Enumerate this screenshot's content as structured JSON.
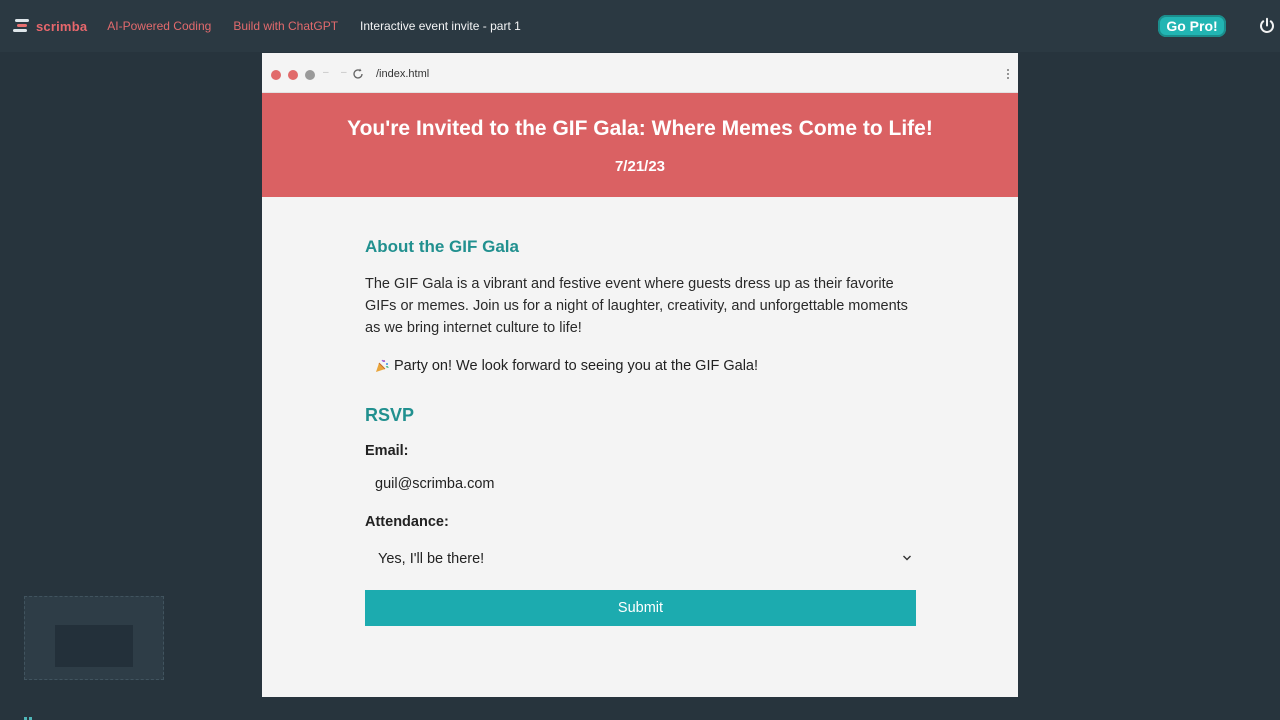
{
  "topbar": {
    "logo_text": "scrimba",
    "breadcrumbs": [
      {
        "label": "AI-Powered Coding"
      },
      {
        "label": "Build with ChatGPT"
      },
      {
        "label": "Interactive event invite - part 1"
      }
    ],
    "go_pro_label": "Go Pro!",
    "accent_color": "#22b5b3",
    "brand_color": "#e8676c"
  },
  "browser": {
    "url": "/index.html"
  },
  "page": {
    "title": "You're Invited to the GIF Gala: Where Memes Come to Life!",
    "date": "7/21/23",
    "about_title": "About the GIF Gala",
    "about_text": "The GIF Gala is a vibrant and festive event where guests dress up as their favorite GIFs or memes. Join us for a night of laughter, creativity, and unforgettable moments as we bring internet culture to life!",
    "party_text": "Party on! We look forward to seeing you at the GIF Gala!",
    "party_icon": "party-popper-icon",
    "rsvp_title": "RSVP",
    "email_label": "Email:",
    "email_value": "guil@scrimba.com",
    "attendance_label": "Attendance:",
    "attendance_selected": "Yes, I'll be there!",
    "submit_label": "Submit",
    "header_color": "#da6163",
    "heading_color": "#21908f",
    "button_color": "#1cabaf"
  }
}
